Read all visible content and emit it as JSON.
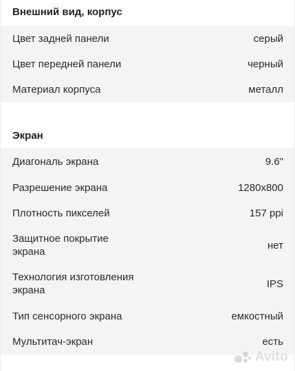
{
  "sections": [
    {
      "title": "Внешний вид, корпус",
      "rows": [
        {
          "label": "Цвет задней панели",
          "value": "серый"
        },
        {
          "label": "Цвет передней панели",
          "value": "черный"
        },
        {
          "label": "Материал корпуса",
          "value": "металл"
        }
      ]
    },
    {
      "title": "Экран",
      "rows": [
        {
          "label": "Диагональ экрана",
          "value": "9.6\""
        },
        {
          "label": "Разрешение экрана",
          "value": "1280x800"
        },
        {
          "label": "Плотность пикселей",
          "value": "157 ppi"
        },
        {
          "label": "Защитное покрытие экрана",
          "value": "нет"
        },
        {
          "label": "Технология изготовления экрана",
          "value": "IPS"
        },
        {
          "label": "Тип сенсорного экрана",
          "value": "емкостный"
        },
        {
          "label": "Мультитач-экран",
          "value": "есть"
        }
      ]
    }
  ],
  "watermark": {
    "icon": "avito-dots-icon",
    "text": "Avito"
  }
}
